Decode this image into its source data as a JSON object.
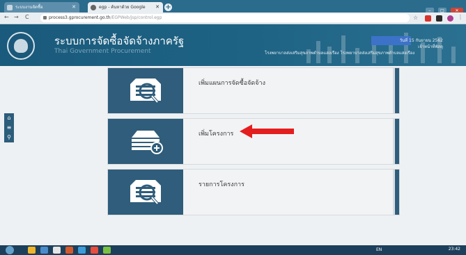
{
  "browser": {
    "tabs": [
      {
        "label": "ระบบงานจัดซื้อ"
      },
      {
        "label": "egp - ค้นหาด้วย Google"
      }
    ],
    "url_host": "process3.gprocurement.go.th",
    "url_path": "/EGPWeb/jsp/control.egp"
  },
  "header": {
    "title_th": "ระบบการจัดซื้อจัดจ้างภาครัฐ",
    "title_en": "Thai Government Procurement",
    "date_text": "วันที่ 15 กันยายน 2562",
    "role_text": "เจ้าหน้าที่พัสดุ",
    "org_text": "โรงพยาบาลส่งเสริมสุขภาพตำบลแสงเรือง โรงพยาบาลส่งเสริมสุขภาพตำบลแสงเรือง"
  },
  "menu": {
    "items": [
      {
        "label": "เพิ่มแผนการจัดซื้อจัดจ้าง",
        "icon": "document-search-icon"
      },
      {
        "label": "เพิ่มโครงการ",
        "icon": "stack-add-icon"
      },
      {
        "label": "รายการโครงการ",
        "icon": "document-search-icon"
      }
    ]
  },
  "annotation": {
    "arrow_color": "#e41e1e"
  },
  "taskbar": {
    "clock": "23:42",
    "lang": "EN"
  },
  "colors": {
    "header_bg": "#1d6083",
    "tile": "#2f5d7b",
    "accent_blue": "#3d72c9"
  }
}
